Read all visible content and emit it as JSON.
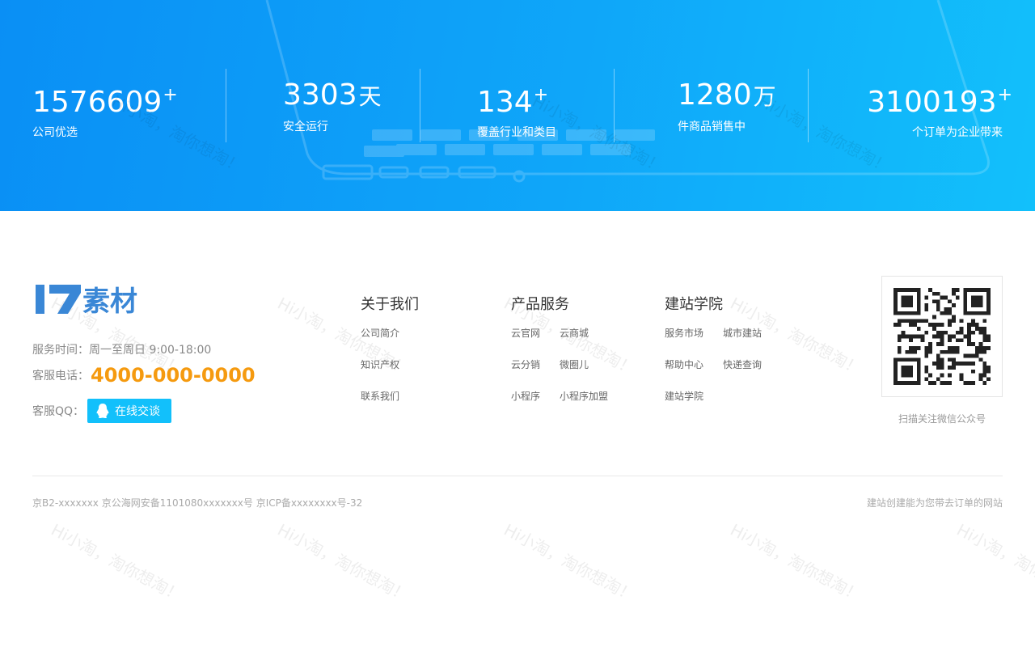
{
  "stats": [
    {
      "number": "1576609",
      "suffix": "+",
      "caption": "公司优选"
    },
    {
      "number": "3303",
      "suffix": "天",
      "caption": "安全运行"
    },
    {
      "number": "134",
      "suffix": "+",
      "caption": "覆盖行业和类目"
    },
    {
      "number": "1280",
      "suffix": "万",
      "caption": "件商品销售中"
    },
    {
      "number": "3100193",
      "suffix": "+",
      "caption": "个订单为企业带来"
    }
  ],
  "watermark": "Hi小淘，淘你想淘！",
  "brand": {
    "logo_text": "素材",
    "logo_color": "#3a87d6"
  },
  "contact": {
    "hours": "服务时间：周一至周日 9:00-18:00",
    "phone_label": "客服电话：",
    "phone": "4000-000-0000",
    "qq_label": "客服QQ：",
    "qq_button": "在线交谈"
  },
  "columns": [
    {
      "title": "关于我们",
      "links": [
        "公司简介",
        "知识产权",
        "联系我们"
      ]
    },
    {
      "title": "产品服务",
      "links": [
        "云官网",
        "云商城",
        "云分销",
        "微圈儿",
        "小程序",
        "小程序加盟"
      ]
    },
    {
      "title": "建站学院",
      "links": [
        "服务市场",
        "城市建站",
        "帮助中心",
        "快递查询",
        "建站学院"
      ]
    }
  ],
  "qr_caption": "扫描关注微信公众号",
  "footer": {
    "icp": "京B2-xxxxxxx 京公海网安备1101080xxxxxxx号 京ICP备xxxxxxxx号-32",
    "slogan": "建站创建能为您带去订单的网站"
  },
  "colors": {
    "band_start": "#0a8ff5",
    "band_end": "#12c0fb",
    "accent_orange": "#f59a0f",
    "button": "#12c0fb"
  }
}
